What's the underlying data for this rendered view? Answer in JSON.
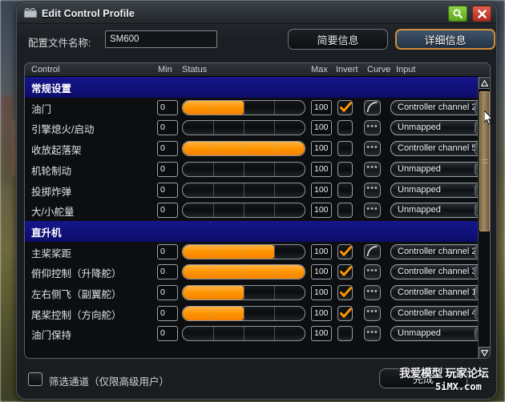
{
  "window": {
    "title": "Edit Control Profile",
    "icon": "film-camera-icon",
    "buttons": {
      "zoom": "zoom-icon",
      "close": "close-icon"
    }
  },
  "form": {
    "name_label": "配置文件名称:",
    "name_value": "SM600",
    "name_placeholder": ""
  },
  "tabs": [
    {
      "label": "简要信息",
      "selected": false
    },
    {
      "label": "详细信息",
      "selected": true
    }
  ],
  "table": {
    "headers": {
      "control": "Control",
      "min": "Min",
      "status": "Status",
      "max": "Max",
      "invert": "Invert",
      "curve": "Curve",
      "input": "Input"
    },
    "rows": [
      {
        "type": "section",
        "control": "常规设置"
      },
      {
        "type": "item",
        "control": "油门",
        "min": "0",
        "max": "100",
        "status": 50,
        "invert": true,
        "curve": "curve-icon",
        "input": "Controller channel 2"
      },
      {
        "type": "item",
        "control": "引擎熄火/启动",
        "min": "0",
        "max": "100",
        "status": 0,
        "invert": false,
        "curve": "dots-icon",
        "input": "Unmapped"
      },
      {
        "type": "item",
        "control": "收放起落架",
        "min": "0",
        "max": "100",
        "status": 100,
        "invert": false,
        "curve": "dots-icon",
        "input": "Controller channel 5"
      },
      {
        "type": "item",
        "control": "机轮制动",
        "min": "0",
        "max": "100",
        "status": 0,
        "invert": false,
        "curve": "dots-icon",
        "input": "Unmapped"
      },
      {
        "type": "item",
        "control": "投掷炸弹",
        "min": "0",
        "max": "100",
        "status": 0,
        "invert": false,
        "curve": "dots-icon",
        "input": "Unmapped"
      },
      {
        "type": "item",
        "control": "大/小舵量",
        "min": "0",
        "max": "100",
        "status": 0,
        "invert": false,
        "curve": "dots-icon",
        "input": "Unmapped"
      },
      {
        "type": "section",
        "control": "直升机"
      },
      {
        "type": "item",
        "control": "主桨桨距",
        "min": "0",
        "max": "100",
        "status": 75,
        "invert": true,
        "curve": "curve-icon",
        "input": "Controller channel 2"
      },
      {
        "type": "item",
        "control": "俯仰控制（升降舵）",
        "min": "0",
        "max": "100",
        "status": 100,
        "invert": true,
        "curve": "dots-icon",
        "input": "Controller channel 3"
      },
      {
        "type": "item",
        "control": "左右侧飞（副翼舵）",
        "min": "0",
        "max": "100",
        "status": 50,
        "invert": true,
        "curve": "dots-icon",
        "input": "Controller channel 1"
      },
      {
        "type": "item",
        "control": "尾桨控制（方向舵）",
        "min": "0",
        "max": "100",
        "status": 50,
        "invert": true,
        "curve": "dots-icon",
        "input": "Controller channel 4"
      },
      {
        "type": "item",
        "control": "油门保持",
        "min": "0",
        "max": "100",
        "status": 0,
        "invert": false,
        "curve": "dots-icon",
        "input": "Unmapped"
      }
    ]
  },
  "scrollbar": {
    "up": "scroll-up-icon",
    "down": "scroll-down-icon",
    "thumb_position_pct": 0,
    "thumb_size_pct": 50
  },
  "footer": {
    "filter_label": "筛选通道（仅限高级用户）",
    "filter_checked": false,
    "done_label": "完成"
  },
  "watermark": {
    "line1": "我爱模型 玩家论坛",
    "line2": "5iMX.com"
  },
  "colors": {
    "accent_orange": "#ff9500",
    "section_blue": "#10107a",
    "tab_highlight": "#d08f3c",
    "close_red": "#b32a1c",
    "zoom_green": "#5aa615"
  }
}
